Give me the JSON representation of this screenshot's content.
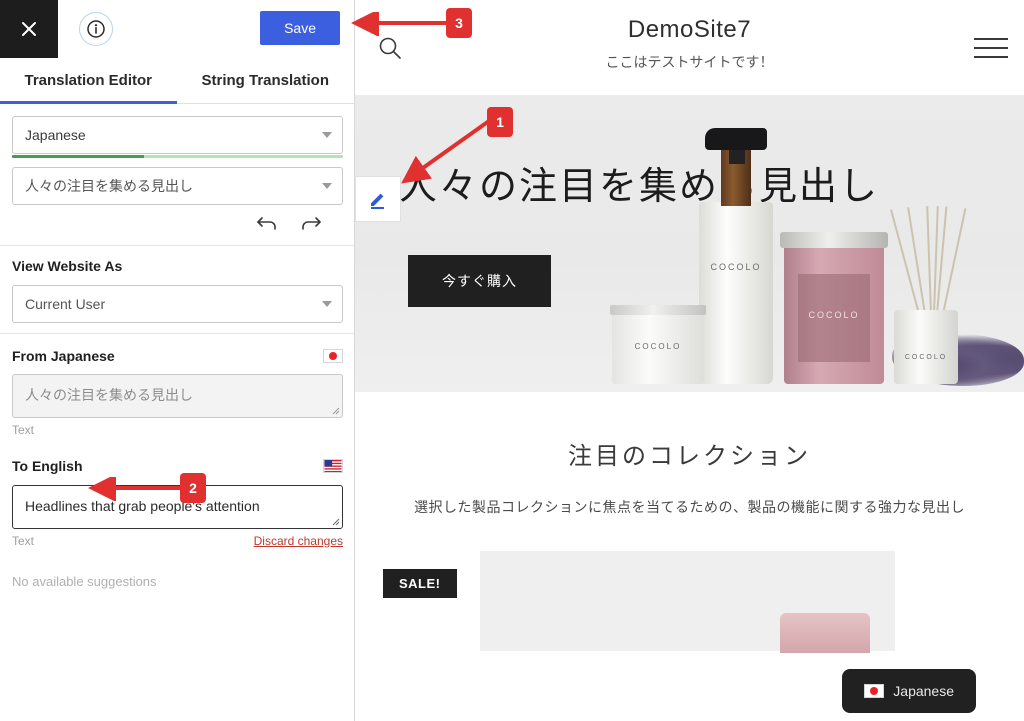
{
  "panel": {
    "close_icon": "close-icon",
    "info_icon": "info-icon",
    "save_label": "Save",
    "tabs": [
      {
        "label": "Translation Editor",
        "active": true
      },
      {
        "label": "String Translation",
        "active": false
      }
    ],
    "language_select": {
      "value": "Japanese",
      "progress_percent": 40
    },
    "string_select": {
      "value": "人々の注目を集める見出し"
    },
    "undo_icon": "undo-icon",
    "redo_icon": "redo-icon",
    "view_website_as": {
      "label": "View Website As",
      "value": "Current User"
    },
    "source": {
      "label": "From Japanese",
      "flag": "flag-japan",
      "value": "人々の注目を集める見出し",
      "caption": "Text"
    },
    "target": {
      "label": "To English",
      "flag": "flag-usa",
      "value": "Headlines that grab people's attention",
      "caption": "Text",
      "discard_label": "Discard changes"
    },
    "suggestions": "No available suggestions"
  },
  "site": {
    "search_icon": "search-icon",
    "title": "DemoSite7",
    "tagline": "ここはテストサイトです！",
    "menu_icon": "hamburger-menu-icon",
    "hero": {
      "edit_icon": "edit-pencil-icon",
      "heading": "人々の注目を集める見出し",
      "cta_label": "今すぐ購入",
      "product_brand": "COCOLO"
    },
    "collection": {
      "title": "注目のコレクション",
      "subtitle": "選択した製品コレクションに焦点を当てるための、製品の機能に関する強力な見出し",
      "sale_badge": "SALE!"
    },
    "language_badge": {
      "label": "Japanese",
      "flag": "flag-japan"
    }
  },
  "annotations": [
    {
      "id": "1",
      "number": "1"
    },
    {
      "id": "2",
      "number": "2"
    },
    {
      "id": "3",
      "number": "3"
    }
  ],
  "colors": {
    "accent_blue": "#3c5fe0",
    "annotation_red": "#e03030",
    "progress_green": "#4a9b4a",
    "dark": "#1d1d1d"
  }
}
